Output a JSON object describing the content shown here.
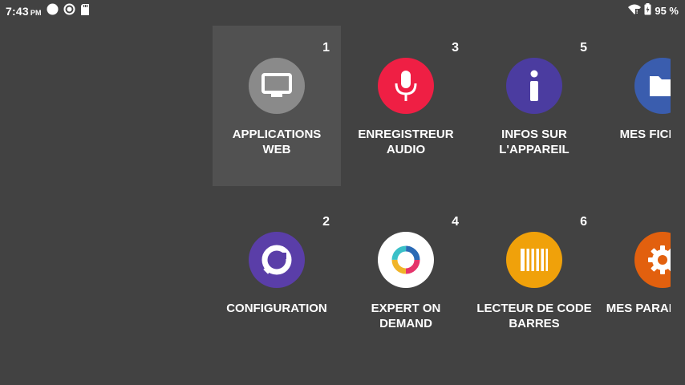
{
  "status_bar": {
    "time": "7:43",
    "ampm": "PM",
    "battery": "95 %",
    "icons": [
      "circle-notification-icon",
      "sync-icon",
      "sd-card-icon",
      "wifi-icon",
      "battery-icon"
    ]
  },
  "colors": {
    "background": "#424242",
    "selected_tile": "#515151",
    "web_apps": "#8a8a8a",
    "audio": "#ef1f44",
    "device_info": "#4b3ca0",
    "files": "#3a5dae",
    "configuration": "#5a3ea8",
    "expert": "#ffffff",
    "barcode": "#f0a10a",
    "settings": "#e2600e"
  },
  "apps": [
    {
      "number": "1",
      "label": "APPLICATIONS\nWEB",
      "icon": "monitor-icon"
    },
    {
      "number": "3",
      "label": "ENREGISTREUR\nAUDIO",
      "icon": "microphone-icon"
    },
    {
      "number": "5",
      "label": "INFOS SUR\nL'APPAREIL",
      "icon": "info-icon"
    },
    {
      "number": "",
      "label": "MES FICHIERS",
      "icon": "folder-icon"
    },
    {
      "number": "2",
      "label": "CONFIGURATION",
      "icon": "wrench-icon"
    },
    {
      "number": "4",
      "label": "EXPERT ON\nDEMAND",
      "icon": "expert-ring-icon"
    },
    {
      "number": "6",
      "label": "LECTEUR DE CODE\nBARRES",
      "icon": "barcode-icon"
    },
    {
      "number": "",
      "label": "MES PARAMÈTRES",
      "icon": "gear-icon"
    }
  ]
}
